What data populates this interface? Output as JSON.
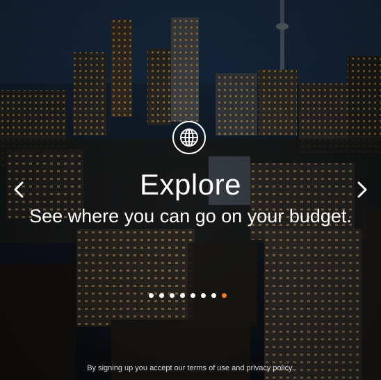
{
  "slide": {
    "icon": "globe-icon",
    "title": "Explore",
    "subtitle": "See where you can go on your budget."
  },
  "navigation": {
    "prev_icon": "chevron-left-icon",
    "next_icon": "chevron-right-icon"
  },
  "pagination": {
    "total": 8,
    "active_index": 7,
    "active_color": "#f07a2c",
    "inactive_color": "#ffffff"
  },
  "footer": {
    "text_before": "By signing up you accept our ",
    "terms_link": "terms of use",
    "text_middle": " and ",
    "privacy_link": "privacy policy",
    "text_after": "."
  },
  "background": {
    "description_icon": "city-skyline-night-image"
  }
}
